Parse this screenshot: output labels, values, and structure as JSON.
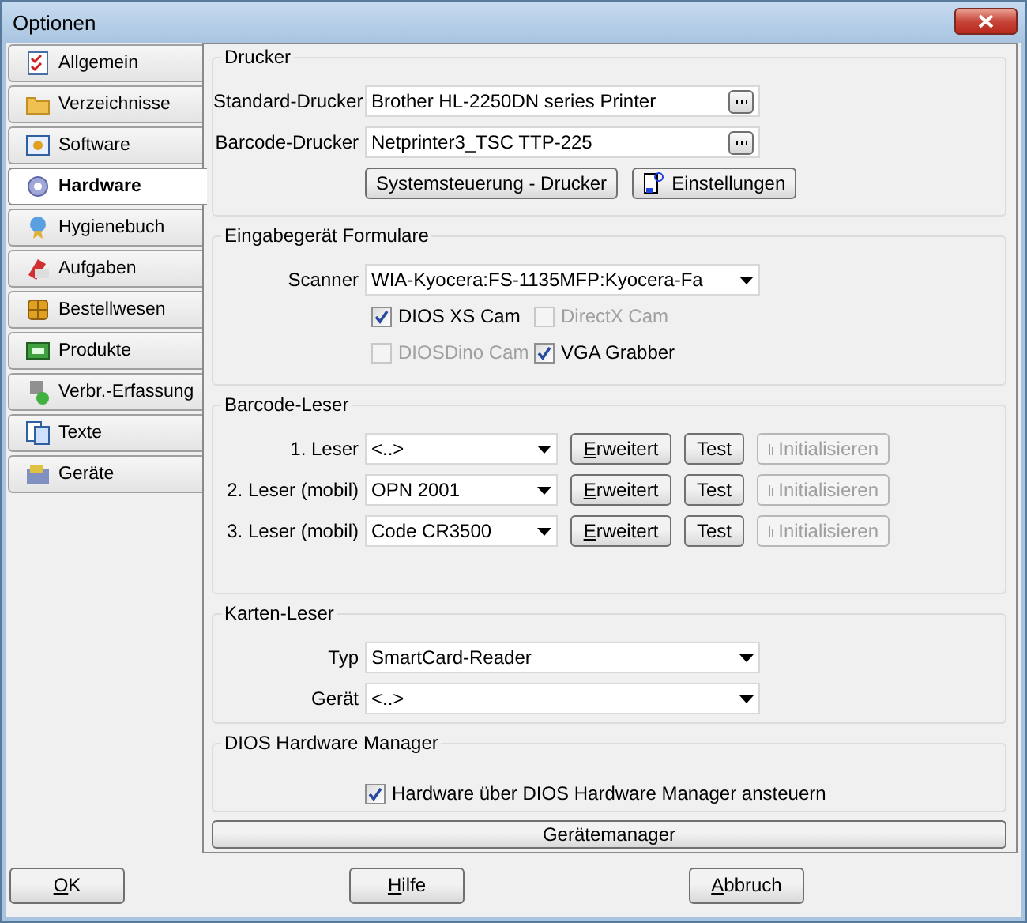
{
  "window": {
    "title": "Optionen"
  },
  "tabs": [
    {
      "label": "Allgemein",
      "selected": false
    },
    {
      "label": "Verzeichnisse",
      "selected": false
    },
    {
      "label": "Software",
      "selected": false
    },
    {
      "label": "Hardware",
      "selected": true
    },
    {
      "label": "Hygienebuch",
      "selected": false
    },
    {
      "label": "Aufgaben",
      "selected": false
    },
    {
      "label": "Bestellwesen",
      "selected": false
    },
    {
      "label": "Produkte",
      "selected": false
    },
    {
      "label": "Verbr.-Erfassung",
      "selected": false
    },
    {
      "label": "Texte",
      "selected": false
    },
    {
      "label": "Geräte",
      "selected": false
    }
  ],
  "drucker": {
    "title": "Drucker",
    "fields": [
      {
        "label": "Standard-Drucker",
        "value": "Brother HL-2250DN series Printer"
      },
      {
        "label": "Barcode-Drucker",
        "value": "Netprinter3_TSC TTP-225"
      }
    ],
    "buttons": [
      {
        "label": "Systemsteuerung - Drucker",
        "kind": "plain"
      },
      {
        "label": "Einstellungen",
        "kind": "icon"
      }
    ]
  },
  "eingabe": {
    "title": "Eingabegerät Formulare",
    "scanner": {
      "label": "Scanner",
      "value": "WIA-Kyocera:FS-1135MFP:Kyocera-Fa"
    },
    "checkboxes": [
      {
        "label": "DIOS XS Cam",
        "checked": true,
        "disabled": false
      },
      {
        "label": "DirectX Cam",
        "checked": false,
        "disabled": true
      },
      {
        "label": "DIOSDino Cam",
        "checked": false,
        "disabled": true
      },
      {
        "label": "VGA Grabber",
        "checked": true,
        "disabled": false
      }
    ]
  },
  "barcode": {
    "title": "Barcode-Leser",
    "rows": [
      {
        "label": "1. Leser",
        "value": "<..>",
        "extended": "Erweitert",
        "test": "Test",
        "init": "Initialisieren",
        "init_disabled": true
      },
      {
        "label": "2. Leser (mobil)",
        "value": "OPN 2001",
        "extended": "Erweitert",
        "test": "Test",
        "init": "Initialisieren",
        "init_disabled": true
      },
      {
        "label": "3. Leser (mobil)",
        "value": "Code CR3500",
        "extended": "Erweitert",
        "test": "Test",
        "init": "Initialisieren",
        "init_disabled": true
      }
    ]
  },
  "karten": {
    "title": "Karten-Leser",
    "fields": [
      {
        "label": "Typ",
        "value": "SmartCard-Reader"
      },
      {
        "label": "Gerät",
        "value": "<..>"
      }
    ]
  },
  "manager": {
    "title": "DIOS Hardware Manager",
    "checkbox": {
      "label": "Hardware über DIOS Hardware Manager ansteuern",
      "checked": true,
      "disabled": false
    },
    "button": "Gerätemanager"
  },
  "footer": [
    {
      "label": "OK",
      "mnemonic": true
    },
    {
      "label": "Hilfe",
      "mnemonic": true
    },
    {
      "label": "Abbruch",
      "mnemonic": true
    }
  ]
}
